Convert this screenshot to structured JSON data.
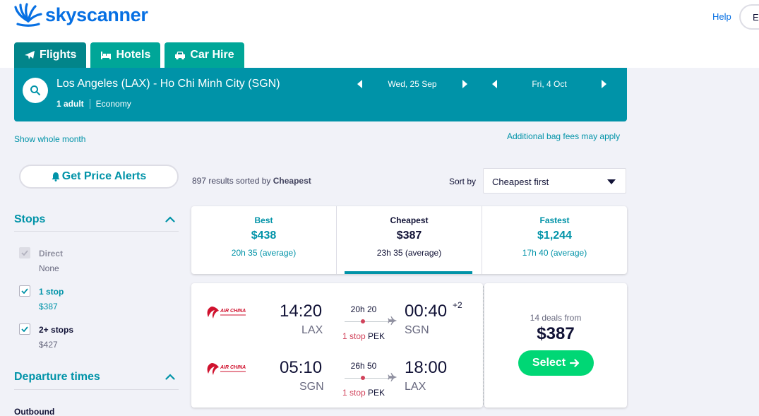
{
  "header": {
    "logo_text": "skyscanner",
    "help": "Help",
    "language_btn": "En"
  },
  "tabs": [
    {
      "label": "Flights",
      "active": true
    },
    {
      "label": "Hotels",
      "active": false
    },
    {
      "label": "Car Hire",
      "active": false
    }
  ],
  "search": {
    "route": "Los Angeles (LAX) - Ho Chi Minh City (SGN)",
    "adults": "1 adult",
    "cabin": "Economy",
    "depart_date": "Wed, 25 Sep",
    "return_date": "Fri, 4 Oct"
  },
  "links": {
    "show_whole_month": "Show whole month",
    "bag_fees": "Additional bag fees may apply"
  },
  "sidebar": {
    "alerts_button": "Get Price Alerts",
    "stops_heading": "Stops",
    "stops": [
      {
        "label": "Direct",
        "sub": "None",
        "checked": true,
        "disabled": true
      },
      {
        "label": "1 stop",
        "sub": "$387",
        "checked": true,
        "disabled": false
      },
      {
        "label": "2+ stops",
        "sub": "$427",
        "checked": true,
        "disabled": false
      }
    ],
    "departure_heading": "Departure times",
    "outbound_label": "Outbound"
  },
  "results": {
    "count": "897 results sorted by",
    "sorted_by": "Cheapest",
    "sort_label": "Sort by",
    "sort_value": "Cheapest first"
  },
  "summary": [
    {
      "title": "Best",
      "price": "$438",
      "duration": "20h 35 (average)",
      "active": false
    },
    {
      "title": "Cheapest",
      "price": "$387",
      "duration": "23h 35 (average)",
      "active": true
    },
    {
      "title": "Fastest",
      "price": "$1,244",
      "duration": "17h 40 (average)",
      "active": false
    }
  ],
  "itinerary": {
    "airline": "AIR CHINA",
    "outbound": {
      "dep_time": "14:20",
      "dep_code": "LAX",
      "duration": "20h 20",
      "stops": "1 stop",
      "stop_airport": "PEK",
      "arr_time": "00:40",
      "arr_code": "SGN",
      "day_offset": "+2"
    },
    "inbound": {
      "dep_time": "05:10",
      "dep_code": "SGN",
      "duration": "26h 50",
      "stops": "1 stop",
      "stop_airport": "PEK",
      "arr_time": "18:00",
      "arr_code": "LAX"
    },
    "deals_from": "14 deals from",
    "price": "$387",
    "select_label": "Select"
  },
  "colors": {
    "brand_blue": "#0770e3",
    "teal": "#0093a8",
    "green": "#00d775",
    "stop_red": "#d1435b"
  }
}
